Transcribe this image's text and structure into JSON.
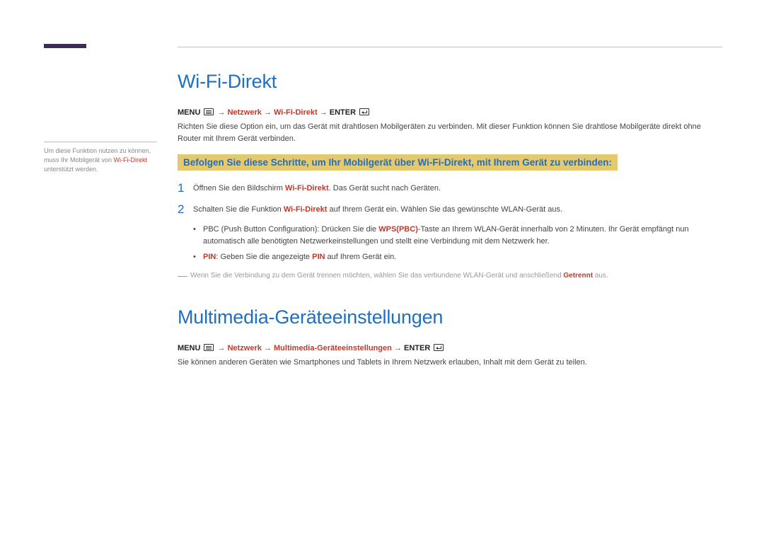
{
  "sidebar": {
    "pre": "Um diese Funktion nutzen zu können, muss Ihr Mobilgerät von ",
    "hl": "Wi-Fi-Direkt",
    "post": " unterstützt werden."
  },
  "section1": {
    "title": "Wi-Fi-Direkt",
    "bc_menu": "MENU",
    "bc_p1": "Netzwerk",
    "bc_p2": "Wi-Fi-Direkt",
    "bc_enter": "ENTER",
    "intro": "Richten Sie diese Option ein, um das Gerät mit drahtlosen Mobilgeräten zu verbinden. Mit dieser Funktion können Sie drahtlose Mobilgeräte direkt ohne Router mit Ihrem Gerät verbinden.",
    "callout": "Befolgen Sie diese Schritte, um Ihr Mobilgerät über Wi-Fi-Direkt, mit Ihrem Gerät zu verbinden:",
    "step1_num": "1",
    "step1_a": "Öffnen Sie den Bildschirm ",
    "step1_hl": "Wi-Fi-Direkt",
    "step1_b": ". Das Gerät sucht nach Geräten.",
    "step2_num": "2",
    "step2_a": "Schalten Sie die Funktion ",
    "step2_hl": "Wi-Fi-Direkt",
    "step2_b": " auf Ihrem Gerät ein. Wählen Sie das gewünschte WLAN-Gerät aus.",
    "sub1_a": "PBC (Push Button Configuration): Drücken Sie die ",
    "sub1_hl": "WPS(PBC)",
    "sub1_b": "-Taste an Ihrem WLAN-Gerät innerhalb von 2 Minuten. Ihr Gerät empfängt nun automatisch alle benötigten Netzwerkeinstellungen und stellt eine Verbindung mit dem Netzwerk her.",
    "sub2_hl1": "PIN",
    "sub2_a": ": Geben Sie die angezeigte ",
    "sub2_hl2": "PIN",
    "sub2_b": " auf Ihrem Gerät ein.",
    "note_a": "Wenn Sie die Verbindung zu dem Gerät trennen möchten, wählen Sie das verbundene WLAN-Gerät und anschließend ",
    "note_hl": "Getrennt",
    "note_b": " aus."
  },
  "section2": {
    "title": "Multimedia-Geräteeinstellungen",
    "bc_menu": "MENU",
    "bc_p1": "Netzwerk",
    "bc_p2": "Multimedia-Geräteeinstellungen",
    "bc_enter": "ENTER",
    "body": "Sie können anderen Geräten wie Smartphones und Tablets in Ihrem Netzwerk erlauben, Inhalt mit dem Gerät zu teilen."
  },
  "glyphs": {
    "arrow": " → ",
    "bullet": "•",
    "dash": "―"
  }
}
